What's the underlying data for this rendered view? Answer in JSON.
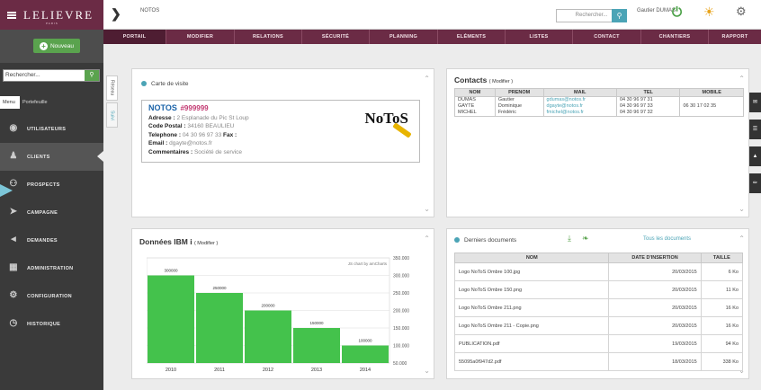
{
  "brand": {
    "logo": "LELIEVRE",
    "sub": "PARIS"
  },
  "sidebar": {
    "new_button": "Nouveau",
    "search_placeholder": "Rechercher...",
    "tabs": [
      "Menu",
      "Portefeuille"
    ],
    "items": [
      {
        "label": "UTILISATEURS",
        "icon": "eye-icon"
      },
      {
        "label": "CLIENTS",
        "icon": "user-icon",
        "active": true
      },
      {
        "label": "PROSPECTS",
        "icon": "group-icon"
      },
      {
        "label": "CAMPAGNE",
        "icon": "paper-plane-icon"
      },
      {
        "label": "DEMANDES",
        "icon": "megaphone-icon"
      },
      {
        "label": "ADMINISTRATION",
        "icon": "institution-icon"
      },
      {
        "label": "CONFIGURATION",
        "icon": "gears-icon"
      },
      {
        "label": "HISTORIQUE",
        "icon": "clock-icon"
      }
    ]
  },
  "topbar": {
    "title": "NOTOS",
    "search_placeholder": "Rechercher...",
    "user": "Gautier DUMAS"
  },
  "menubar": [
    "PORTAIL",
    "MODIFIER",
    "RELATIONS",
    "SÉCURITÉ",
    "PLANNING",
    "ELÉMENTS",
    "LISTES",
    "CONTACT",
    "CHANTIERS",
    "RAPPORT"
  ],
  "side_tabs": [
    "Réseau",
    "Suivi"
  ],
  "card": {
    "title": "Carte de visite",
    "name": "NOTOS",
    "number": "#999999",
    "adresse_label": "Adresse : ",
    "adresse": "2 Esplanade du Pic St Loup",
    "cp_label": "Code Postal : ",
    "cp": "34160 BEAULIEU",
    "tel_label": "Telephone : ",
    "tel": "04 30 96 97 33",
    "fax_label": " Fax :",
    "email_label": "Email : ",
    "email": "dgayte@notos.fr",
    "comment_label": "Commentaires : ",
    "comment": "Société de service",
    "logo": "NoToS"
  },
  "contacts": {
    "title": "Contacts",
    "modifier": "( Modifier )",
    "headers": [
      "NOM",
      "PRENOM",
      "MAIL",
      "TEL",
      "MOBILE"
    ],
    "rows": [
      [
        "DUMAS",
        "Gautier",
        "gdumas@notos.fr",
        "04 30 96 97 31",
        ""
      ],
      [
        "GAYTE",
        "Dominique",
        "dgayte@notos.fr",
        "04 30 96 97 33",
        "06 30 17 02 35"
      ],
      [
        "MICHEL",
        "Frédéric",
        "fmichel@notos.fr",
        "04 30 96 97 32",
        ""
      ]
    ]
  },
  "ibm": {
    "title": "Données IBM i",
    "modifier": "( Modifier )",
    "credit": "JS chart by amCharts"
  },
  "chart_data": {
    "type": "bar",
    "categories": [
      "2010",
      "2011",
      "2012",
      "2013",
      "2014"
    ],
    "values": [
      300000,
      250000,
      200000,
      150000,
      100000
    ],
    "value_labels": [
      "300000",
      "250000",
      "200000",
      "150000",
      "100000"
    ],
    "y_ticks": [
      "350.000",
      "300.000",
      "250.000",
      "200.000",
      "150.000",
      "100.000",
      "50.000"
    ],
    "ylim": [
      50000,
      350000
    ],
    "color": "#44c24c",
    "grid": true
  },
  "docs": {
    "title": "Derniers documents",
    "all_link": "Tous les documents",
    "headers": [
      "NOM",
      "DATE D'INSERTION",
      "TAILLE"
    ],
    "rows": [
      [
        "Logo NoToS Ombre 100.jpg",
        "20/03/2015",
        "6 Ko"
      ],
      [
        "Logo NoToS Ombre 150.png",
        "20/03/2015",
        "11 Ko"
      ],
      [
        "Logo NoToS Ombre 211.png",
        "20/03/2015",
        "16 Ko"
      ],
      [
        "Logo NoToS Ombre 211 - Copie.png",
        "20/03/2015",
        "16 Ko"
      ],
      [
        "PUBLICATION.pdf",
        "19/03/2015",
        "94 Ko"
      ],
      [
        "55095a0f947d2.pdf",
        "18/03/2015",
        "338 Ko"
      ]
    ]
  }
}
